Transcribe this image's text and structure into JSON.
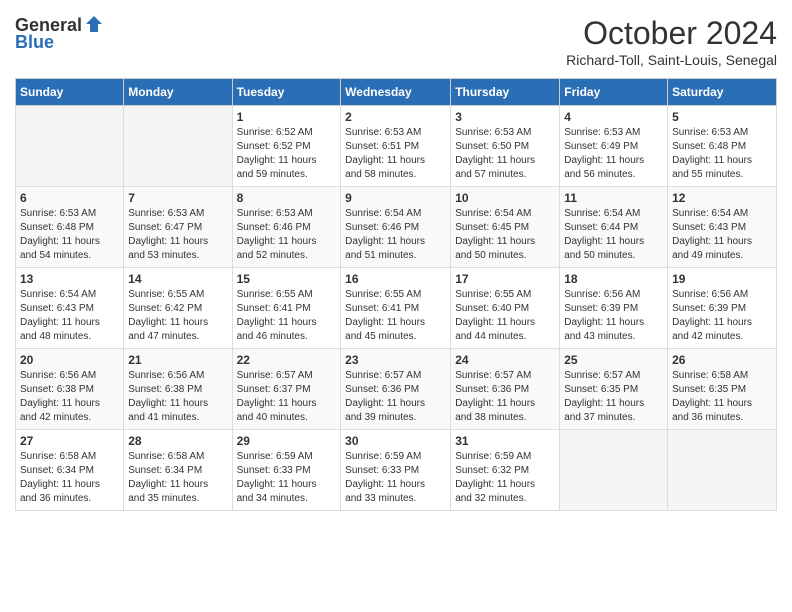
{
  "logo": {
    "general": "General",
    "blue": "Blue"
  },
  "title": {
    "month": "October 2024",
    "location": "Richard-Toll, Saint-Louis, Senegal"
  },
  "days_of_week": [
    "Sunday",
    "Monday",
    "Tuesday",
    "Wednesday",
    "Thursday",
    "Friday",
    "Saturday"
  ],
  "weeks": [
    [
      {
        "day": "",
        "info": ""
      },
      {
        "day": "",
        "info": ""
      },
      {
        "day": "1",
        "info": "Sunrise: 6:52 AM\nSunset: 6:52 PM\nDaylight: 11 hours\nand 59 minutes."
      },
      {
        "day": "2",
        "info": "Sunrise: 6:53 AM\nSunset: 6:51 PM\nDaylight: 11 hours\nand 58 minutes."
      },
      {
        "day": "3",
        "info": "Sunrise: 6:53 AM\nSunset: 6:50 PM\nDaylight: 11 hours\nand 57 minutes."
      },
      {
        "day": "4",
        "info": "Sunrise: 6:53 AM\nSunset: 6:49 PM\nDaylight: 11 hours\nand 56 minutes."
      },
      {
        "day": "5",
        "info": "Sunrise: 6:53 AM\nSunset: 6:48 PM\nDaylight: 11 hours\nand 55 minutes."
      }
    ],
    [
      {
        "day": "6",
        "info": "Sunrise: 6:53 AM\nSunset: 6:48 PM\nDaylight: 11 hours\nand 54 minutes."
      },
      {
        "day": "7",
        "info": "Sunrise: 6:53 AM\nSunset: 6:47 PM\nDaylight: 11 hours\nand 53 minutes."
      },
      {
        "day": "8",
        "info": "Sunrise: 6:53 AM\nSunset: 6:46 PM\nDaylight: 11 hours\nand 52 minutes."
      },
      {
        "day": "9",
        "info": "Sunrise: 6:54 AM\nSunset: 6:46 PM\nDaylight: 11 hours\nand 51 minutes."
      },
      {
        "day": "10",
        "info": "Sunrise: 6:54 AM\nSunset: 6:45 PM\nDaylight: 11 hours\nand 50 minutes."
      },
      {
        "day": "11",
        "info": "Sunrise: 6:54 AM\nSunset: 6:44 PM\nDaylight: 11 hours\nand 50 minutes."
      },
      {
        "day": "12",
        "info": "Sunrise: 6:54 AM\nSunset: 6:43 PM\nDaylight: 11 hours\nand 49 minutes."
      }
    ],
    [
      {
        "day": "13",
        "info": "Sunrise: 6:54 AM\nSunset: 6:43 PM\nDaylight: 11 hours\nand 48 minutes."
      },
      {
        "day": "14",
        "info": "Sunrise: 6:55 AM\nSunset: 6:42 PM\nDaylight: 11 hours\nand 47 minutes."
      },
      {
        "day": "15",
        "info": "Sunrise: 6:55 AM\nSunset: 6:41 PM\nDaylight: 11 hours\nand 46 minutes."
      },
      {
        "day": "16",
        "info": "Sunrise: 6:55 AM\nSunset: 6:41 PM\nDaylight: 11 hours\nand 45 minutes."
      },
      {
        "day": "17",
        "info": "Sunrise: 6:55 AM\nSunset: 6:40 PM\nDaylight: 11 hours\nand 44 minutes."
      },
      {
        "day": "18",
        "info": "Sunrise: 6:56 AM\nSunset: 6:39 PM\nDaylight: 11 hours\nand 43 minutes."
      },
      {
        "day": "19",
        "info": "Sunrise: 6:56 AM\nSunset: 6:39 PM\nDaylight: 11 hours\nand 42 minutes."
      }
    ],
    [
      {
        "day": "20",
        "info": "Sunrise: 6:56 AM\nSunset: 6:38 PM\nDaylight: 11 hours\nand 42 minutes."
      },
      {
        "day": "21",
        "info": "Sunrise: 6:56 AM\nSunset: 6:38 PM\nDaylight: 11 hours\nand 41 minutes."
      },
      {
        "day": "22",
        "info": "Sunrise: 6:57 AM\nSunset: 6:37 PM\nDaylight: 11 hours\nand 40 minutes."
      },
      {
        "day": "23",
        "info": "Sunrise: 6:57 AM\nSunset: 6:36 PM\nDaylight: 11 hours\nand 39 minutes."
      },
      {
        "day": "24",
        "info": "Sunrise: 6:57 AM\nSunset: 6:36 PM\nDaylight: 11 hours\nand 38 minutes."
      },
      {
        "day": "25",
        "info": "Sunrise: 6:57 AM\nSunset: 6:35 PM\nDaylight: 11 hours\nand 37 minutes."
      },
      {
        "day": "26",
        "info": "Sunrise: 6:58 AM\nSunset: 6:35 PM\nDaylight: 11 hours\nand 36 minutes."
      }
    ],
    [
      {
        "day": "27",
        "info": "Sunrise: 6:58 AM\nSunset: 6:34 PM\nDaylight: 11 hours\nand 36 minutes."
      },
      {
        "day": "28",
        "info": "Sunrise: 6:58 AM\nSunset: 6:34 PM\nDaylight: 11 hours\nand 35 minutes."
      },
      {
        "day": "29",
        "info": "Sunrise: 6:59 AM\nSunset: 6:33 PM\nDaylight: 11 hours\nand 34 minutes."
      },
      {
        "day": "30",
        "info": "Sunrise: 6:59 AM\nSunset: 6:33 PM\nDaylight: 11 hours\nand 33 minutes."
      },
      {
        "day": "31",
        "info": "Sunrise: 6:59 AM\nSunset: 6:32 PM\nDaylight: 11 hours\nand 32 minutes."
      },
      {
        "day": "",
        "info": ""
      },
      {
        "day": "",
        "info": ""
      }
    ]
  ]
}
